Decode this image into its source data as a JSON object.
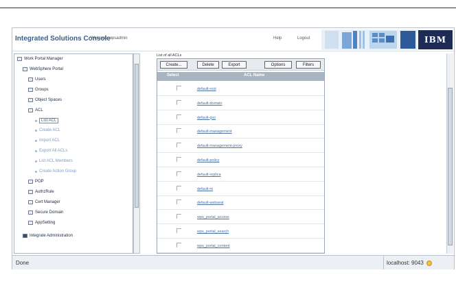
{
  "header": {
    "app_title": "Integrated Solutions Console",
    "welcome": "Welcome wpsadmin",
    "help": "Help",
    "logout": "Logout",
    "logo_text": "IBM"
  },
  "nav": {
    "items": [
      {
        "label": "Work Portal Manager",
        "kind": "section"
      },
      {
        "label": "WebSphere Portal",
        "kind": "section"
      },
      {
        "label": "Users",
        "kind": "node"
      },
      {
        "label": "Groups",
        "kind": "node"
      },
      {
        "label": "Object Spaces",
        "kind": "node"
      },
      {
        "label": "ACL",
        "kind": "node"
      },
      {
        "label": "List ACL",
        "kind": "task-selected"
      },
      {
        "label": "Create ACL",
        "kind": "task"
      },
      {
        "label": "Import ACL",
        "kind": "task"
      },
      {
        "label": "Export All ACLs",
        "kind": "task"
      },
      {
        "label": "List ACL Members",
        "kind": "task"
      },
      {
        "label": "Create Action Group",
        "kind": "task"
      },
      {
        "label": "POP",
        "kind": "node"
      },
      {
        "label": "AuthzRule",
        "kind": "node"
      },
      {
        "label": "Cert Manager",
        "kind": "node"
      },
      {
        "label": "Secure Domain",
        "kind": "node"
      },
      {
        "label": "AppSetting",
        "kind": "node"
      },
      {
        "label": "Integrate Administration",
        "kind": "section"
      }
    ]
  },
  "content": {
    "title": "List of all ACLs",
    "buttons": [
      "Create...",
      "Delete",
      "Export",
      "Options",
      "Filters"
    ],
    "columns": {
      "select": "Select",
      "name": "ACL Name"
    },
    "rows": [
      "default-root",
      "default-domain",
      "default-gso",
      "default-management",
      "default-management-proxy",
      "default-policy",
      "default-replica",
      "default-nt",
      "default-webseal",
      "wps_portal_access",
      "wps_portal_search",
      "wps_portal_content"
    ]
  },
  "status": {
    "text": "Done",
    "zone": "localhost: 9043"
  }
}
